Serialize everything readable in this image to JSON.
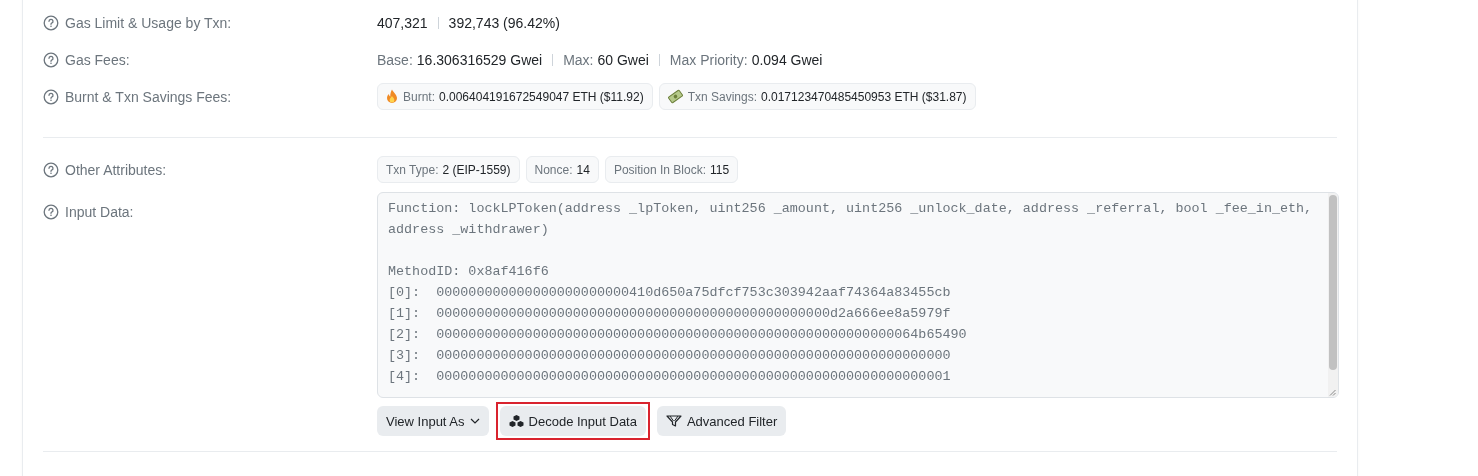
{
  "rows": [
    {
      "label": "Gas Limit & Usage by Txn:",
      "kind": "text",
      "parts": [
        {
          "value": "407,321"
        },
        {
          "value": "392,743 (96.42%)"
        }
      ]
    },
    {
      "label": "Gas Fees:",
      "kind": "text",
      "parts": [
        {
          "label": "Base:",
          "value": "16.306316529 Gwei"
        },
        {
          "label": "Max:",
          "value": "60 Gwei"
        },
        {
          "label": "Max Priority:",
          "value": "0.094 Gwei"
        }
      ]
    },
    {
      "label": "Burnt & Txn Savings Fees:",
      "kind": "badges",
      "badges": [
        {
          "kind": "flame",
          "label": "Burnt:",
          "value": "0.006404191672549047 ETH ($11.92)"
        },
        {
          "kind": "savings",
          "label": "Txn Savings:",
          "value": "0.017123470485450953 ETH ($31.87)"
        }
      ]
    },
    {
      "kind": "divider"
    },
    {
      "label": "Other Attributes:",
      "kind": "badges",
      "badges": [
        {
          "label": "Txn Type:",
          "value": "2 (EIP-1559)"
        },
        {
          "label": "Nonce:",
          "value": "14"
        },
        {
          "label": "Position In Block:",
          "value": "115"
        }
      ]
    },
    {
      "label": "Input Data:",
      "kind": "input",
      "signature": [
        "Function: lockLPToken(address _lpToken, uint256 _amount, uint256 _unlock_date, address _referral, bool _fee_in_eth,",
        "address _withdrawer)"
      ],
      "method_id": "MethodID: 0x8af416f6",
      "params": [
        "[0]:  000000000000000000000000410d650a75dfcf753c303942aaf74364a83455cb",
        "[1]:  0000000000000000000000000000000000000000000000000d2a666ee8a5979f",
        "[2]:  000000000000000000000000000000000000000000000000000000000064b65490",
        "[3]:  0000000000000000000000000000000000000000000000000000000000000000",
        "[4]:  0000000000000000000000000000000000000000000000000000000000000001"
      ],
      "buttons": [
        {
          "kind": "dropdown",
          "label": "View Input As",
          "highlighted": false
        },
        {
          "kind": "decode",
          "label": "Decode Input Data",
          "highlighted": true
        },
        {
          "kind": "filter",
          "label": "Advanced Filter",
          "highlighted": false
        }
      ]
    }
  ]
}
